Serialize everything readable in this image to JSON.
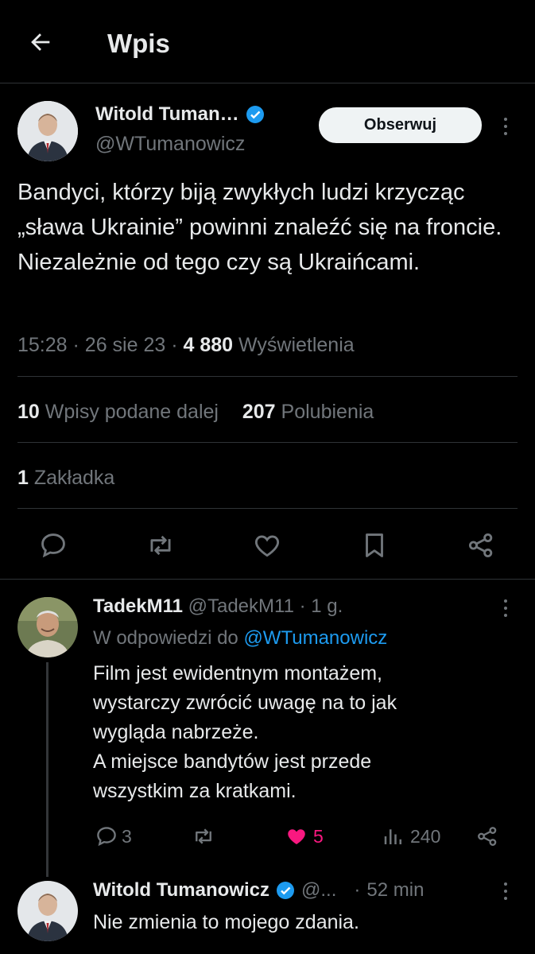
{
  "header": {
    "title": "Wpis"
  },
  "tweet": {
    "author_name": "Witold Tuman…",
    "author_handle": "@WTumanowicz",
    "follow_label": "Obserwuj",
    "text": "Bandyci, którzy biją zwykłych ludzi krzycząc „sława Ukrainie” powinni znaleźć się na froncie. Niezależnie od tego czy są Ukraińcami.",
    "time": "15:28",
    "date": "26 sie 23",
    "views_count": "4 880",
    "views_label": "Wyświetlenia",
    "retweets_count": "10",
    "retweets_label": "Wpisy podane dalej",
    "likes_count": "207",
    "likes_label": "Polubienia",
    "bookmarks_count": "1",
    "bookmarks_label": "Zakładka"
  },
  "replies": [
    {
      "author_name": "TadekM11",
      "author_handle": "@TadekM11",
      "age": "1 g.",
      "replying_prefix": "W odpowiedzi do",
      "replying_to": "@WTumanowicz",
      "text": "Film jest ewidentnym montażem,\nwystarczy zwrócić uwagę na to jak\nwygląda nabrzeże.\nA miejsce bandytów jest przede\nwszystkim za kratkami.",
      "reply_count": "3",
      "like_count": "5",
      "view_count": "240"
    },
    {
      "author_name": "Witold Tumanowicz",
      "author_handle": "@...",
      "age": "52 min",
      "text": "Nie zmienia to mojego zdania."
    }
  ],
  "colors": {
    "background": "#000000",
    "text": "#e7e9ea",
    "muted": "#71767b",
    "accent": "#1d9bf0",
    "like": "#f91880",
    "divider": "#2f3336"
  },
  "icons": [
    "back-arrow-icon",
    "verified-badge-icon",
    "more-icon",
    "reply-icon",
    "retweet-icon",
    "like-icon",
    "bookmark-icon",
    "share-icon",
    "views-icon"
  ]
}
